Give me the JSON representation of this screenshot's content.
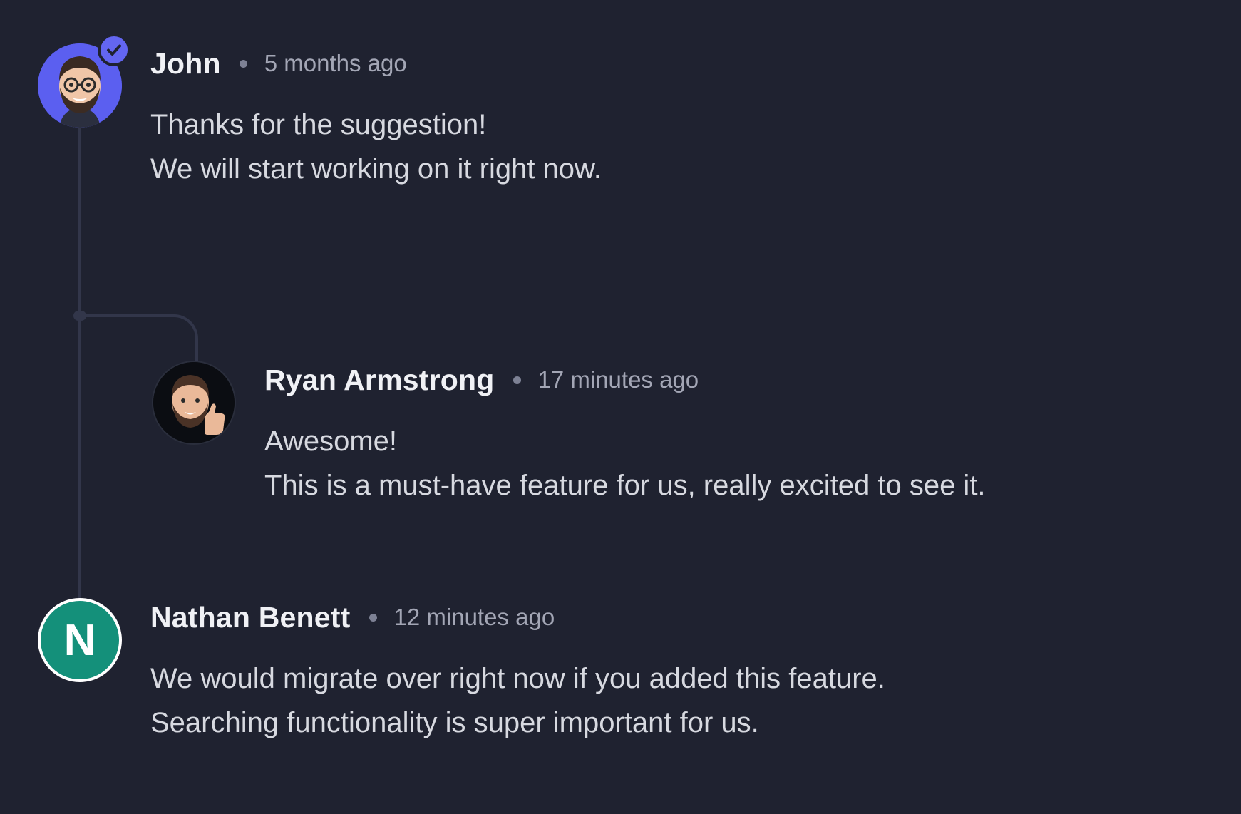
{
  "comments": [
    {
      "author": "John",
      "time": "5 months ago",
      "lines": [
        "Thanks for the suggestion!",
        "We will start working on it right now."
      ],
      "avatar": "memoji-glasses-beard",
      "avatar_bg": "#5b5ff0",
      "verified": true
    },
    {
      "author": "Ryan Armstrong",
      "time": "17 minutes ago",
      "lines": [
        "Awesome!",
        "This is a must-have feature for us, really excited to see it."
      ],
      "avatar": "memoji-thumbs-up",
      "avatar_bg": "#0b0d12"
    },
    {
      "author": "Nathan Benett",
      "time": "12 minutes ago",
      "lines": [
        "We would migrate over right now if you added this feature.",
        "Searching functionality is super important for us."
      ],
      "avatar_initial": "N",
      "avatar_bg": "#14907a"
    }
  ],
  "colors": {
    "background": "#1f2230",
    "thread_line": "#32364a",
    "verified_badge": "#6366f1"
  },
  "icons": {
    "verified": "check-badge-icon",
    "separator": "dot-separator"
  }
}
